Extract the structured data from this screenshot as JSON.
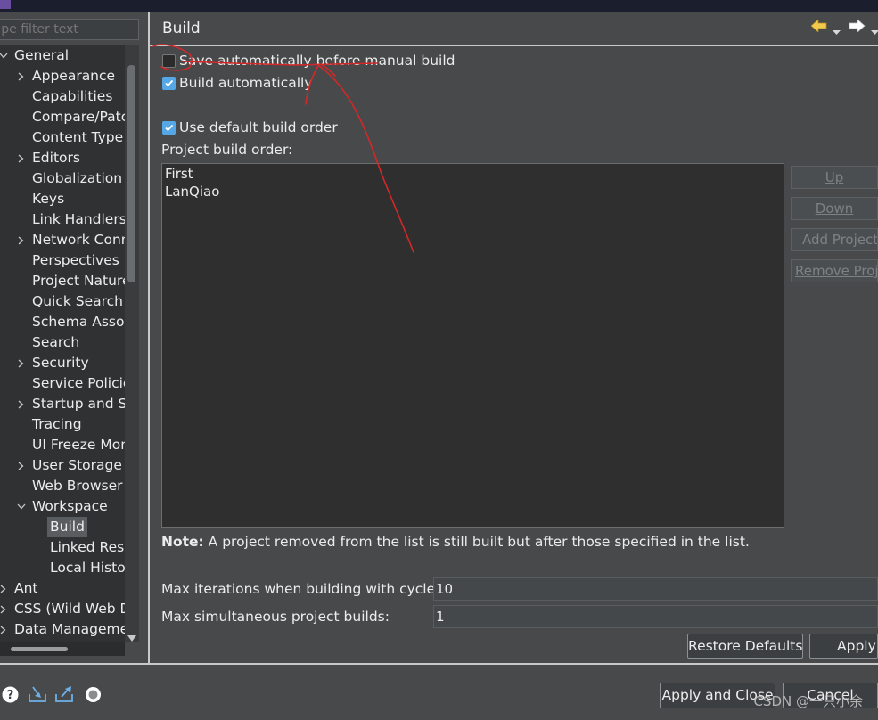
{
  "filter": {
    "placeholder": "ype filter text"
  },
  "tree": {
    "items": [
      {
        "label": "General",
        "level": 0,
        "state": "expanded"
      },
      {
        "label": "Appearance",
        "level": 1,
        "state": "collapsed"
      },
      {
        "label": "Capabilities",
        "level": 1,
        "state": "leaf"
      },
      {
        "label": "Compare/Patc",
        "level": 1,
        "state": "leaf"
      },
      {
        "label": "Content Type",
        "level": 1,
        "state": "leaf"
      },
      {
        "label": "Editors",
        "level": 1,
        "state": "collapsed"
      },
      {
        "label": "Globalization",
        "level": 1,
        "state": "leaf"
      },
      {
        "label": "Keys",
        "level": 1,
        "state": "leaf"
      },
      {
        "label": "Link Handlers",
        "level": 1,
        "state": "leaf"
      },
      {
        "label": "Network Conn",
        "level": 1,
        "state": "collapsed"
      },
      {
        "label": "Perspectives",
        "level": 1,
        "state": "leaf"
      },
      {
        "label": "Project Nature",
        "level": 1,
        "state": "leaf"
      },
      {
        "label": "Quick Search",
        "level": 1,
        "state": "leaf"
      },
      {
        "label": "Schema Assoc",
        "level": 1,
        "state": "leaf"
      },
      {
        "label": "Search",
        "level": 1,
        "state": "leaf"
      },
      {
        "label": "Security",
        "level": 1,
        "state": "collapsed"
      },
      {
        "label": "Service Policie",
        "level": 1,
        "state": "leaf"
      },
      {
        "label": "Startup and Sh",
        "level": 1,
        "state": "collapsed"
      },
      {
        "label": "Tracing",
        "level": 1,
        "state": "leaf"
      },
      {
        "label": "UI Freeze Mon",
        "level": 1,
        "state": "leaf"
      },
      {
        "label": "User Storage",
        "level": 1,
        "state": "collapsed"
      },
      {
        "label": "Web Browser",
        "level": 1,
        "state": "leaf"
      },
      {
        "label": "Workspace",
        "level": 1,
        "state": "expanded"
      },
      {
        "label": "Build",
        "level": 2,
        "state": "leaf",
        "selected": true
      },
      {
        "label": "Linked Reso",
        "level": 2,
        "state": "leaf"
      },
      {
        "label": "Local Histo",
        "level": 2,
        "state": "leaf"
      },
      {
        "label": "Ant",
        "level": 0,
        "state": "collapsed"
      },
      {
        "label": "CSS (Wild Web D",
        "level": 0,
        "state": "collapsed"
      },
      {
        "label": "Data Manageme",
        "level": 0,
        "state": "collapsed"
      }
    ]
  },
  "page": {
    "title": "Build",
    "nav_back_icon": "arrow-left-icon",
    "nav_forward_icon": "arrow-right-icon",
    "save_automatically": {
      "label": "Save automatically before manual build",
      "checked": false
    },
    "build_automatically": {
      "label": "Build automatically",
      "checked": true
    },
    "use_default_build_order": {
      "label": "Use default build order",
      "checked": true
    },
    "project_build_order_label": "Project build order:",
    "projects": [
      "First",
      "LanQiao"
    ],
    "buttons": {
      "up": "Up",
      "down": "Down",
      "add_project": "Add Project...",
      "remove_project": "Remove Project"
    },
    "note_prefix": "Note:",
    "note_text": " A project removed from the list is still built but after those specified in the list.",
    "max_iterations": {
      "label": "Max iterations when building with cycles:",
      "value": "10"
    },
    "max_simultaneous": {
      "label": "Max simultaneous project builds:",
      "value": "1"
    },
    "restore_defaults": "Restore Defaults",
    "apply": "Apply"
  },
  "footer": {
    "icons": [
      "help-icon",
      "import-icon",
      "export-icon",
      "oomph-icon"
    ],
    "apply_and_close": "Apply and Close",
    "cancel": "Cancel",
    "watermark": "CSDN @一只小余"
  },
  "colors": {
    "accent": "#56a7e6",
    "annotation": "#d42828",
    "background": "#47494b"
  }
}
